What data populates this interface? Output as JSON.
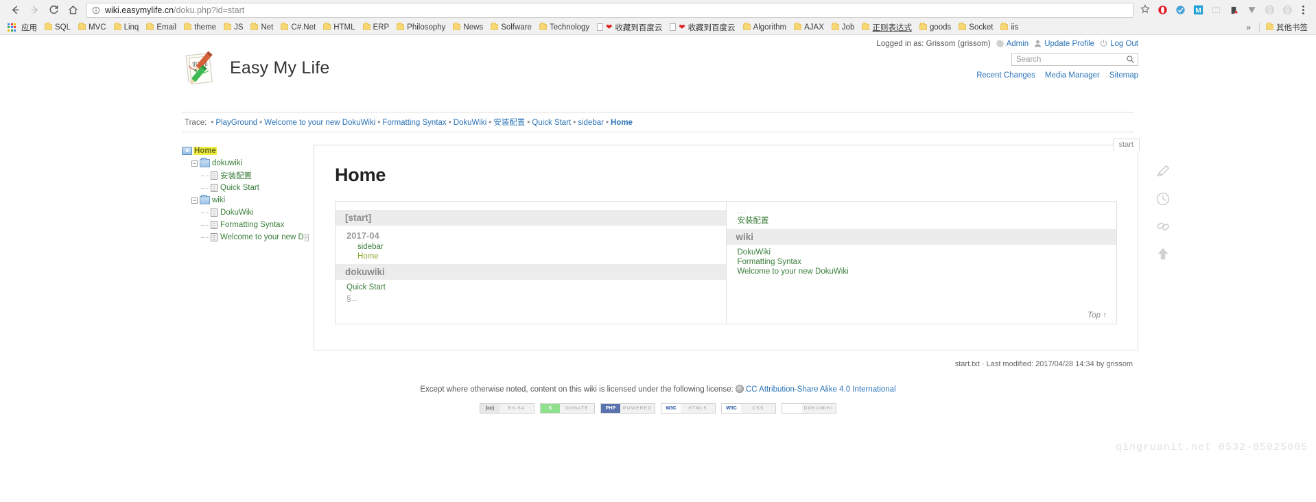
{
  "browser": {
    "nav": {
      "back": "back-arrow",
      "forward": "forward-arrow",
      "reload": "reload",
      "home": "home"
    },
    "url": {
      "domain": "wiki.easymylife.cn",
      "path": "/doku.php?id=start",
      "info_tooltip": "View site information"
    },
    "bookmarks": [
      {
        "label": "应用",
        "type": "apps"
      },
      {
        "label": "SQL",
        "type": "folder"
      },
      {
        "label": "MVC",
        "type": "folder"
      },
      {
        "label": "Linq",
        "type": "folder"
      },
      {
        "label": "Email",
        "type": "folder"
      },
      {
        "label": "theme",
        "type": "folder"
      },
      {
        "label": "JS",
        "type": "folder"
      },
      {
        "label": "Net",
        "type": "folder"
      },
      {
        "label": "C#.Net",
        "type": "folder"
      },
      {
        "label": "HTML",
        "type": "folder"
      },
      {
        "label": "ERP",
        "type": "folder"
      },
      {
        "label": "Philosophy",
        "type": "folder"
      },
      {
        "label": "News",
        "type": "folder"
      },
      {
        "label": "Solfware",
        "type": "folder"
      },
      {
        "label": "Technology",
        "type": "folder"
      },
      {
        "label": "收藏到百度云",
        "type": "heart"
      },
      {
        "label": "收藏到百度云",
        "type": "heart"
      },
      {
        "label": "Algorithm",
        "type": "folder"
      },
      {
        "label": "AJAX",
        "type": "folder"
      },
      {
        "label": "Job",
        "type": "folder"
      },
      {
        "label": "正则表达式",
        "type": "folder",
        "underline": true
      },
      {
        "label": "goods",
        "type": "folder"
      },
      {
        "label": "Socket",
        "type": "folder"
      },
      {
        "label": "iis",
        "type": "folder"
      }
    ],
    "overflow_label": "»",
    "other_bookmarks": "其他书签",
    "extensions": [
      "opera-icon",
      "shield-icon",
      "m-icon",
      "columns-icon",
      "evernote-icon",
      "v-icon",
      "grid-icon-1",
      "grid-icon-2"
    ],
    "menu": "chrome-menu"
  },
  "site": {
    "title": "Easy My Life",
    "logo_text": "[[DW]]"
  },
  "user": {
    "logged_in_text": "Logged in as: Grissom (grissom)",
    "admin_label": "Admin",
    "update_profile_label": "Update Profile",
    "logout_label": "Log Out"
  },
  "search": {
    "placeholder": "Search",
    "value": ""
  },
  "topnav": [
    {
      "label": "Recent Changes"
    },
    {
      "label": "Media Manager"
    },
    {
      "label": "Sitemap"
    }
  ],
  "trace": {
    "label": "Trace:",
    "items": [
      {
        "label": "PlayGround",
        "current": false
      },
      {
        "label": "Welcome to your new DokuWiki",
        "current": false
      },
      {
        "label": "Formatting Syntax",
        "current": false
      },
      {
        "label": "DokuWiki",
        "current": false
      },
      {
        "label": "安装配置",
        "current": false
      },
      {
        "label": "Quick Start",
        "current": false
      },
      {
        "label": "sidebar",
        "current": false
      },
      {
        "label": "Home",
        "current": true
      }
    ],
    "separator": "•"
  },
  "sidebar_tree": [
    {
      "label": "Home",
      "type": "home",
      "depth": 0,
      "current": true
    },
    {
      "label": "dokuwiki",
      "type": "folder",
      "depth": 1,
      "toggle": "−"
    },
    {
      "label": "安装配置",
      "type": "page",
      "depth": 2
    },
    {
      "label": "Quick Start",
      "type": "page",
      "depth": 2
    },
    {
      "label": "wiki",
      "type": "folder",
      "depth": 1,
      "toggle": "−"
    },
    {
      "label": "DokuWiki",
      "type": "page",
      "depth": 2
    },
    {
      "label": "Formatting Syntax",
      "type": "page",
      "depth": 2
    },
    {
      "label": "Welcome to your new D",
      "type": "page",
      "depth": 2,
      "truncated": true,
      "trunc_mark": "»"
    }
  ],
  "content": {
    "tab_label": "start",
    "heading": "Home",
    "index_left": {
      "section_title": "[start]",
      "subhead": "2017-04",
      "items": [
        {
          "label": "sidebar",
          "highlight": false
        },
        {
          "label": "Home",
          "highlight": true
        }
      ],
      "section2_title": "dokuwiki",
      "items2": [
        {
          "label": "Quick Start",
          "highlight": false
        }
      ],
      "section_mark": "§..."
    },
    "index_right": {
      "dots": "...",
      "pre_items": [
        {
          "label": "安装配置"
        }
      ],
      "section_title": "wiki",
      "items": [
        {
          "label": "DokuWiki"
        },
        {
          "label": "Formatting Syntax"
        },
        {
          "label": "Welcome to your new DokuWiki"
        }
      ]
    },
    "top_link": "Top ↑"
  },
  "tools": [
    {
      "name": "edit-page",
      "icon": "pencil-icon"
    },
    {
      "name": "old-revisions",
      "icon": "clock-icon"
    },
    {
      "name": "backlinks",
      "icon": "link-icon"
    },
    {
      "name": "back-to-top",
      "icon": "up-arrow-icon"
    }
  ],
  "footer": {
    "last_modified": "start.txt · Last modified: 2017/04/28 14:34 by grissom",
    "license_prefix": "Except where otherwise noted, content on this wiki is licensed under the following license:",
    "license_link": "CC Attribution-Share Alike 4.0 International",
    "badges": [
      {
        "left": "(cc)",
        "right": "BY-SA",
        "cls": "b-cc"
      },
      {
        "left": "$",
        "right": "DONATE",
        "cls": "b-donate"
      },
      {
        "left": "PHP",
        "right": "POWERED",
        "cls": "b-php"
      },
      {
        "left": "W3C",
        "right": "HTML5",
        "cls": "b-html5"
      },
      {
        "left": "W3C",
        "right": "CSS",
        "cls": "b-css"
      },
      {
        "left": "",
        "right": "DOKUWIKI",
        "cls": "b-doku"
      }
    ],
    "watermark": "qingruanit.net 0532-85025005"
  },
  "colors": {
    "link": "#2b73b7",
    "wiki_link": "#3a7d3a",
    "current_highlight": "#eded3f",
    "chrome_bg": "#f1f1f1"
  }
}
